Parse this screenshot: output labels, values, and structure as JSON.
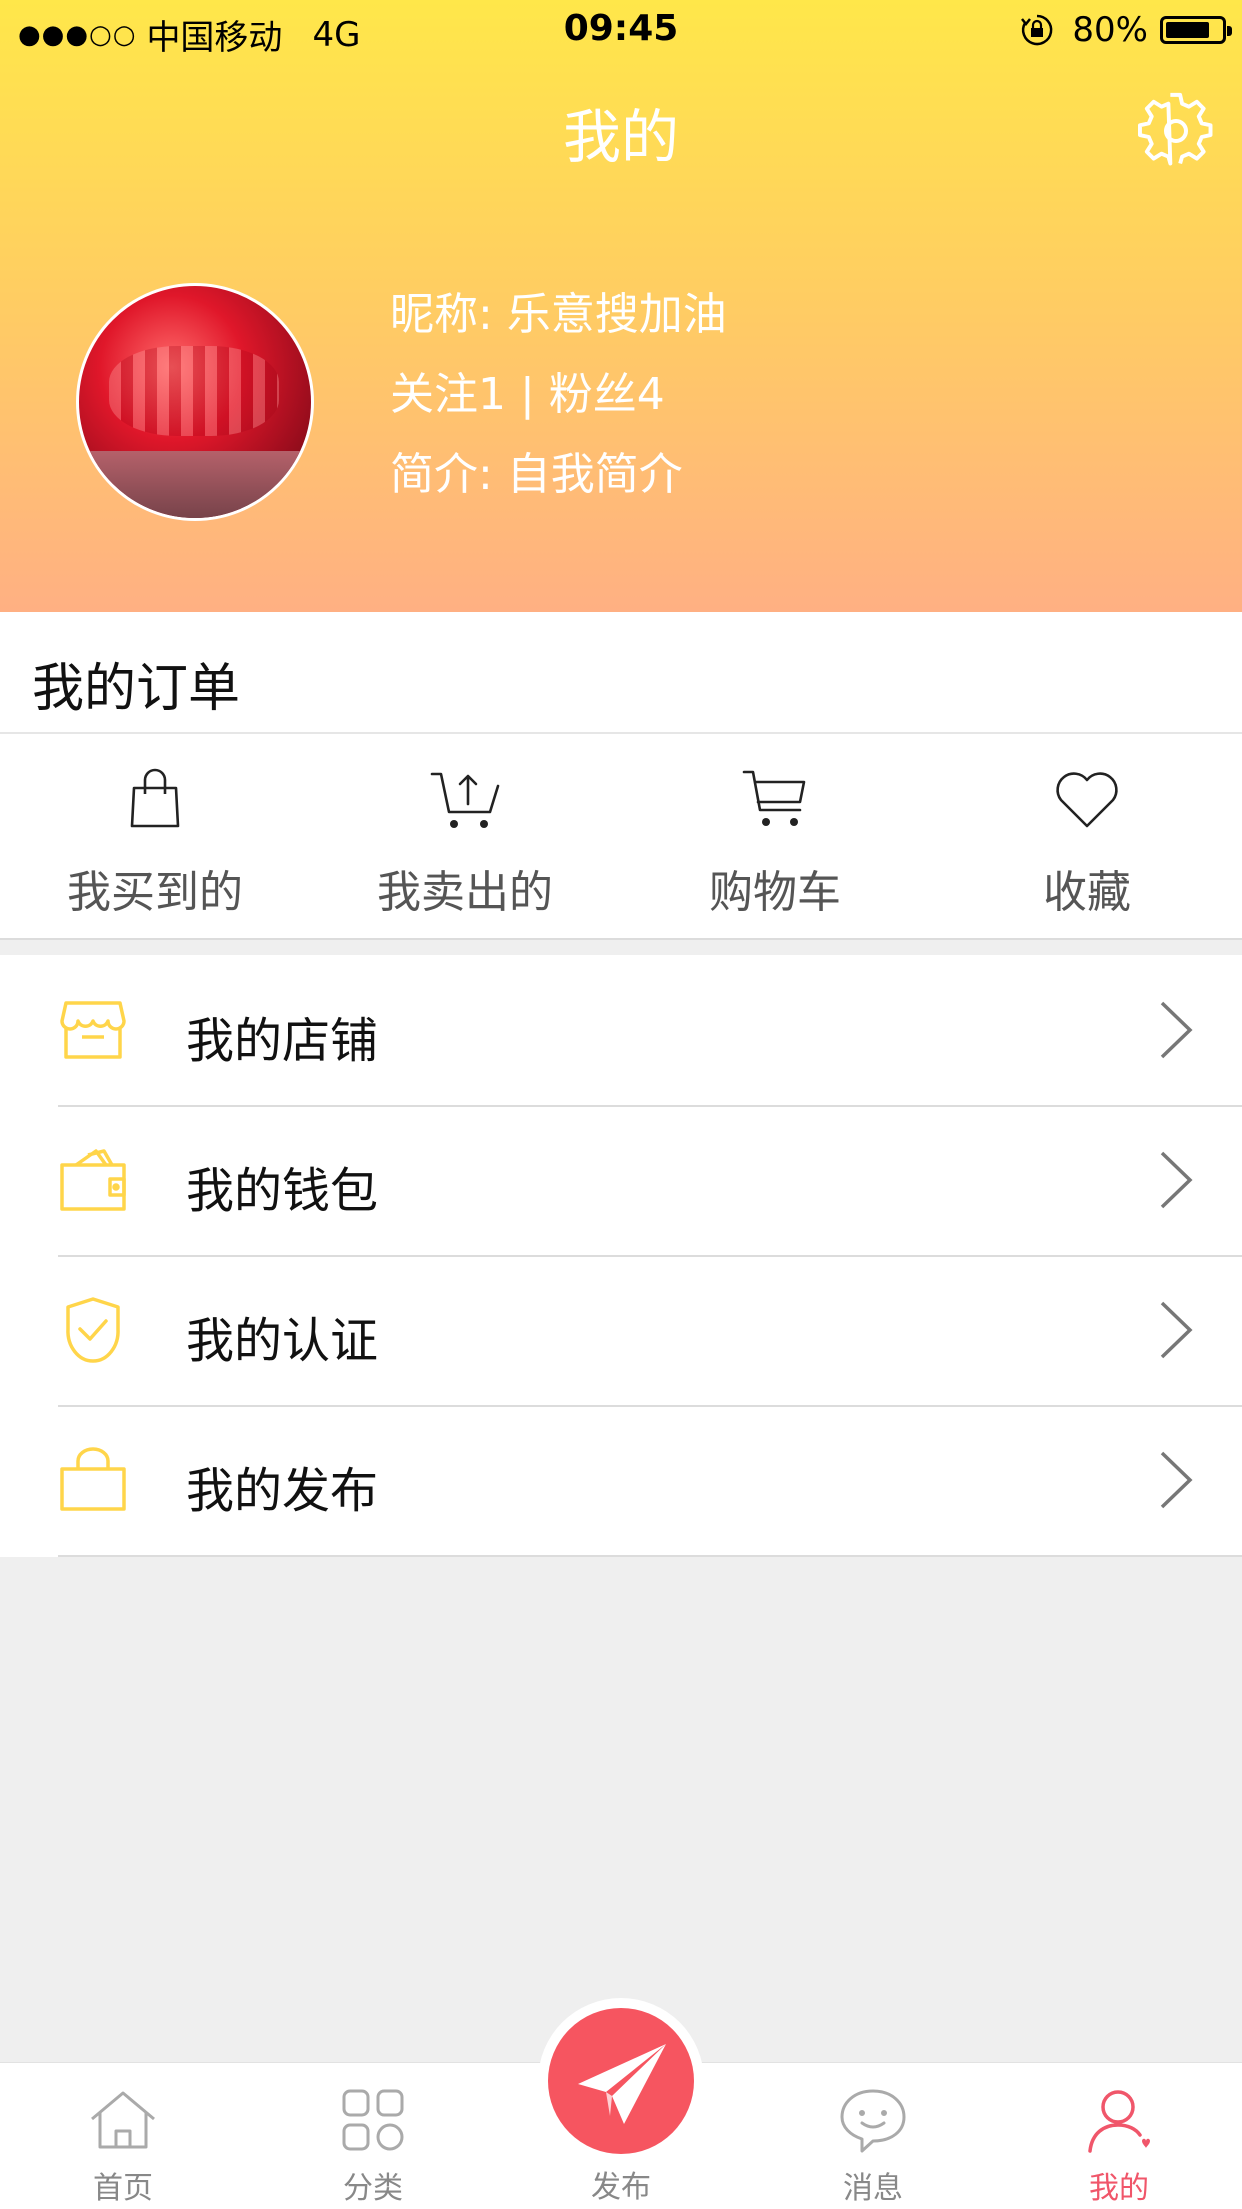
{
  "status_bar": {
    "signal": "●●●○○",
    "carrier": "中国移动",
    "network": "4G",
    "time": "09:45",
    "battery": "80%",
    "battery_level": 0.8
  },
  "header": {
    "title": "我的",
    "settings_icon": "gear-icon"
  },
  "profile": {
    "nickname": "昵称: 乐意搜加油",
    "follow_fans": "关注1 | 粉丝4",
    "bio": "简介: 自我简介"
  },
  "orders": {
    "title": "我的订单",
    "items": [
      {
        "label": "我买到的",
        "icon": "shopping-bag-icon"
      },
      {
        "label": "我卖出的",
        "icon": "cart-upload-icon"
      },
      {
        "label": "购物车",
        "icon": "cart-icon"
      },
      {
        "label": "收藏",
        "icon": "heart-icon"
      }
    ]
  },
  "menu": [
    {
      "label": "我的店铺",
      "icon": "store-icon"
    },
    {
      "label": "我的钱包",
      "icon": "wallet-icon"
    },
    {
      "label": "我的认证",
      "icon": "shield-check-icon"
    },
    {
      "label": "我的发布",
      "icon": "bag-icon"
    }
  ],
  "tabbar": {
    "items": [
      {
        "label": "首页",
        "icon": "home-icon"
      },
      {
        "label": "分类",
        "icon": "grid-icon"
      },
      {
        "label": "发布",
        "icon": "paper-plane-icon"
      },
      {
        "label": "消息",
        "icon": "chat-bubble-icon"
      },
      {
        "label": "我的",
        "icon": "user-icon"
      }
    ],
    "active": "我的"
  },
  "colors": {
    "header_top": "#ffe74a",
    "header_bottom": "#ffb083",
    "accent_yellow": "#ffd54a",
    "active_tab": "#f0566a",
    "publish_button": "#f65560"
  }
}
